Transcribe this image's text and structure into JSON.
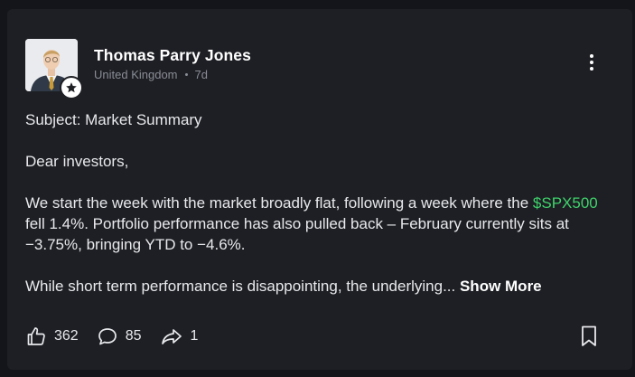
{
  "post": {
    "author": {
      "name": "Thomas Parry Jones",
      "location": "United Kingdom",
      "age": "7d",
      "badge_icon": "star-icon"
    },
    "subject_line": "Subject: Market Summary",
    "greeting": "Dear investors,",
    "para1_before": "We start the week with the market broadly flat, following a week where the",
    "ticker": "$SPX500",
    "para1_after_ticker": "fell 1.4%. Portfolio performance has also pulled back – February currently sits at −3.75%, bringing YTD to −4.6%.",
    "para2": "While short term performance is disappointing, the underlying...",
    "show_more": "Show More"
  },
  "actions": {
    "likes": "362",
    "comments": "85",
    "shares": "1"
  },
  "colors": {
    "background": "#14151a",
    "card": "#1e1f24",
    "ticker": "#3fd36b",
    "muted": "#8a8d96",
    "text": "#e8e9ec"
  }
}
